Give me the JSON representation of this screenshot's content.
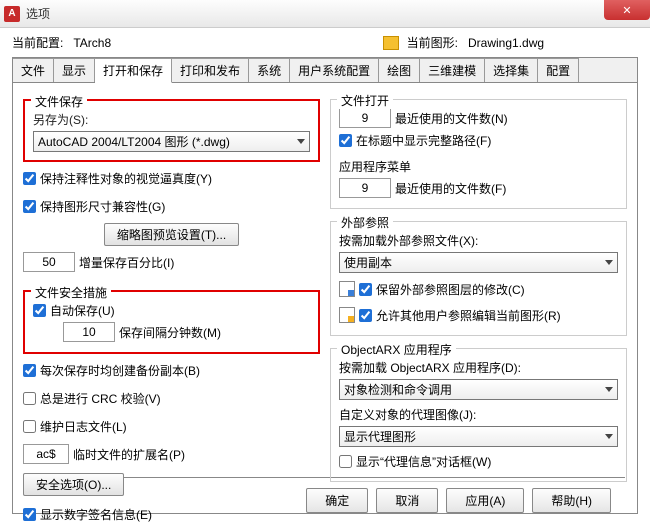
{
  "window": {
    "title": "选项"
  },
  "profile": {
    "current_label": "当前配置:",
    "current_value": "TArch8",
    "drawing_label": "当前图形:",
    "drawing_value": "Drawing1.dwg"
  },
  "tabs": [
    "文件",
    "显示",
    "打开和保存",
    "打印和发布",
    "系统",
    "用户系统配置",
    "绘图",
    "三维建模",
    "选择集",
    "配置"
  ],
  "active_tab": "打开和保存",
  "left": {
    "file_save": {
      "title": "文件保存",
      "save_as_label": "另存为(S):",
      "save_as_value": "AutoCAD 2004/LT2004 图形 (*.dwg)",
      "keep_annot": "保持注释性对象的视觉逼真度(Y)",
      "keep_size": "保持图形尺寸兼容性(G)",
      "thumb_btn": "缩略图预览设置(T)...",
      "inc_value": "50",
      "inc_label": "增量保存百分比(I)"
    },
    "security": {
      "title": "文件安全措施",
      "autosave": "自动保存(U)",
      "interval_value": "10",
      "interval_label": "保存间隔分钟数(M)",
      "backup": "每次保存时均创建备份副本(B)",
      "crc": "总是进行 CRC 校验(V)",
      "log": "维护日志文件(L)",
      "ext_value": "ac$",
      "ext_label": "临时文件的扩展名(P)",
      "sec_btn": "安全选项(O)...",
      "digsig": "显示数字签名信息(E)"
    }
  },
  "right": {
    "open": {
      "title": "文件打开",
      "recent_value": "9",
      "recent_label": "最近使用的文件数(N)",
      "fullpath": "在标题中显示完整路径(F)"
    },
    "appmenu": {
      "title": "应用程序菜单",
      "recent_value": "9",
      "recent_label": "最近使用的文件数(F)"
    },
    "xref": {
      "title": "外部参照",
      "demand_label": "按需加载外部参照文件(X):",
      "demand_value": "使用副本",
      "retain": "保留外部参照图层的修改(C)",
      "allow": "允许其他用户参照编辑当前图形(R)"
    },
    "arx": {
      "title": "ObjectARX 应用程序",
      "demand_label": "按需加载 ObjectARX 应用程序(D):",
      "demand_value": "对象检测和命令调用",
      "proxy_label": "自定义对象的代理图像(J):",
      "proxy_value": "显示代理图形",
      "proxy_dlg": "显示“代理信息”对话框(W)"
    }
  },
  "buttons": {
    "ok": "确定",
    "cancel": "取消",
    "apply": "应用(A)",
    "help": "帮助(H)"
  }
}
